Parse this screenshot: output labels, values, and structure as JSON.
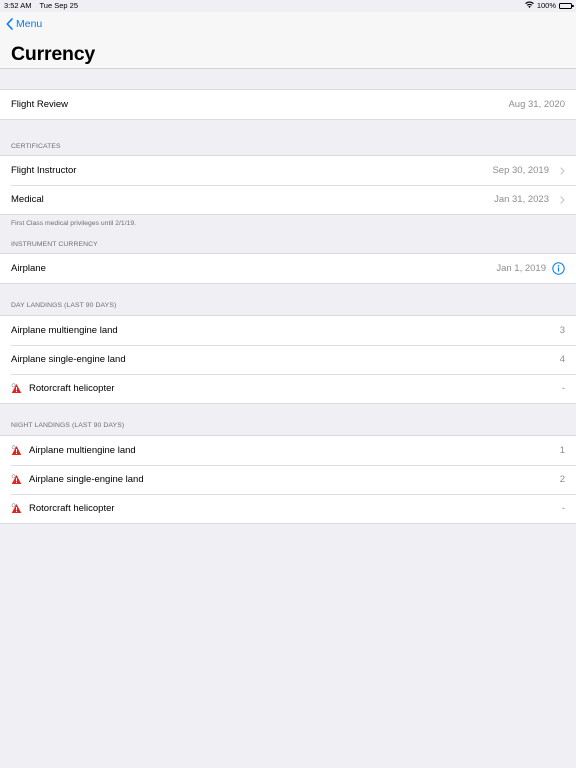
{
  "status_bar": {
    "time": "3:52 AM",
    "date": "Tue Sep 25",
    "battery": "100%"
  },
  "nav": {
    "back_label": "Menu",
    "title": "Currency"
  },
  "flight_review": {
    "label": "Flight Review",
    "value": "Aug 31, 2020"
  },
  "certificates": {
    "header": "CERTIFICATES",
    "rows": [
      {
        "label": "Flight Instructor",
        "value": "Sep 30, 2019"
      },
      {
        "label": "Medical",
        "value": "Jan 31, 2023"
      }
    ],
    "footer": "First Class medical privileges until 2/1/19."
  },
  "instrument": {
    "header": "INSTRUMENT CURRENCY",
    "rows": [
      {
        "label": "Airplane",
        "value": "Jan 1, 2019"
      }
    ]
  },
  "day_landings": {
    "header": "DAY LANDINGS (LAST 90 DAYS)",
    "rows": [
      {
        "label": "Airplane multiengine land",
        "value": "3"
      },
      {
        "label": "Airplane single-engine land",
        "value": "4"
      },
      {
        "label": "Rotorcraft helicopter",
        "value": "-"
      }
    ]
  },
  "night_landings": {
    "header": "NIGHT LANDINGS (LAST 90 DAYS)",
    "rows": [
      {
        "label": "Airplane multiengine land",
        "value": "1"
      },
      {
        "label": "Airplane single-engine land",
        "value": "2"
      },
      {
        "label": "Rotorcraft helicopter",
        "value": "-"
      }
    ]
  },
  "colors": {
    "accent": "#007aff",
    "warning": "#e8231e",
    "background": "#efeff4"
  }
}
